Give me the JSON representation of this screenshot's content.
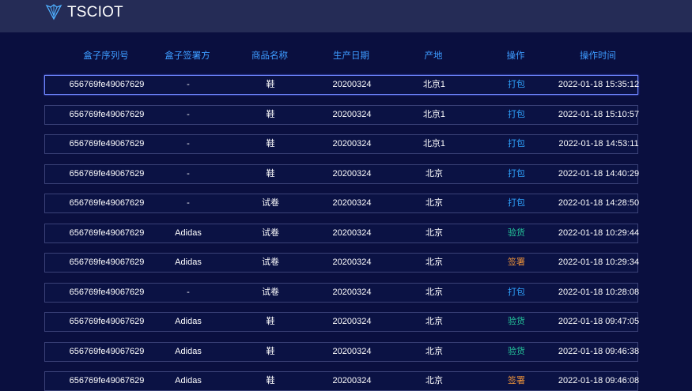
{
  "header": {
    "brand": "TSCIOT",
    "logo_icon": "shield-leaf-logo"
  },
  "colors": {
    "background": "#0a0f3f",
    "header": "#252c56",
    "column_header": "#3d9bff",
    "op_pack": "#2fa4ff",
    "op_check": "#24c59a",
    "op_sign": "#e8903a"
  },
  "table": {
    "columns": [
      "盒子序列号",
      "盒子签署方",
      "商品名称",
      "生产日期",
      "产地",
      "操作",
      "操作时间"
    ],
    "rows": [
      {
        "serial": "656769fe49067629",
        "signer": "-",
        "product": "鞋",
        "date": "20200324",
        "origin": "北京1",
        "op": "打包",
        "op_type": "pack",
        "time": "2022-01-18 15:35:12",
        "active": true
      },
      {
        "serial": "656769fe49067629",
        "signer": "-",
        "product": "鞋",
        "date": "20200324",
        "origin": "北京1",
        "op": "打包",
        "op_type": "pack",
        "time": "2022-01-18 15:10:57"
      },
      {
        "serial": "656769fe49067629",
        "signer": "-",
        "product": "鞋",
        "date": "20200324",
        "origin": "北京1",
        "op": "打包",
        "op_type": "pack",
        "time": "2022-01-18 14:53:11"
      },
      {
        "serial": "656769fe49067629",
        "signer": "-",
        "product": "鞋",
        "date": "20200324",
        "origin": "北京",
        "op": "打包",
        "op_type": "pack",
        "time": "2022-01-18 14:40:29"
      },
      {
        "serial": "656769fe49067629",
        "signer": "-",
        "product": "试卷",
        "date": "20200324",
        "origin": "北京",
        "op": "打包",
        "op_type": "pack",
        "time": "2022-01-18 14:28:50"
      },
      {
        "serial": "656769fe49067629",
        "signer": "Adidas",
        "product": "试卷",
        "date": "20200324",
        "origin": "北京",
        "op": "验货",
        "op_type": "check",
        "time": "2022-01-18 10:29:44"
      },
      {
        "serial": "656769fe49067629",
        "signer": "Adidas",
        "product": "试卷",
        "date": "20200324",
        "origin": "北京",
        "op": "签署",
        "op_type": "sign",
        "time": "2022-01-18 10:29:34"
      },
      {
        "serial": "656769fe49067629",
        "signer": "-",
        "product": "试卷",
        "date": "20200324",
        "origin": "北京",
        "op": "打包",
        "op_type": "pack",
        "time": "2022-01-18 10:28:08"
      },
      {
        "serial": "656769fe49067629",
        "signer": "Adidas",
        "product": "鞋",
        "date": "20200324",
        "origin": "北京",
        "op": "验货",
        "op_type": "check",
        "time": "2022-01-18 09:47:05"
      },
      {
        "serial": "656769fe49067629",
        "signer": "Adidas",
        "product": "鞋",
        "date": "20200324",
        "origin": "北京",
        "op": "验货",
        "op_type": "check",
        "time": "2022-01-18 09:46:38"
      },
      {
        "serial": "656769fe49067629",
        "signer": "Adidas",
        "product": "鞋",
        "date": "20200324",
        "origin": "北京",
        "op": "签署",
        "op_type": "sign",
        "time": "2022-01-18 09:46:08"
      }
    ]
  }
}
